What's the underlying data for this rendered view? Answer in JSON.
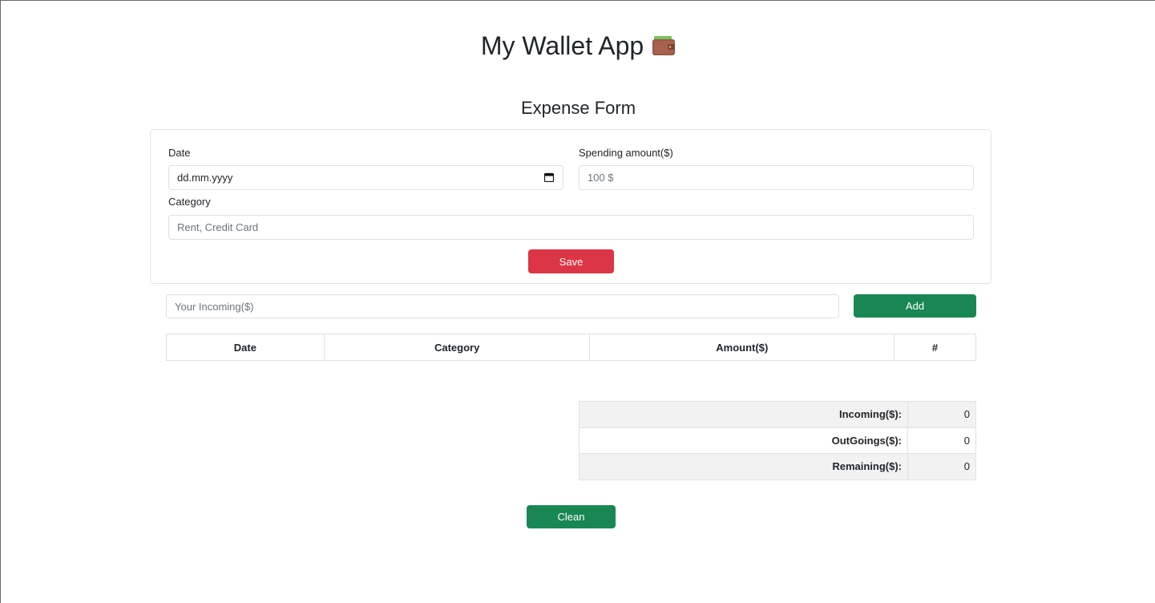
{
  "header": {
    "title": "My Wallet App",
    "icon": "wallet-icon"
  },
  "expense_form": {
    "heading": "Expense Form",
    "date_label": "Date",
    "date_value": "dd.mm.yyyy",
    "amount_label": "Spending amount($)",
    "amount_placeholder": "100 $",
    "category_label": "Category",
    "category_placeholder": "Rent, Credit Card",
    "save_label": "Save"
  },
  "incoming": {
    "placeholder": "Your Incoming($)",
    "add_label": "Add"
  },
  "transactions": {
    "columns": [
      "Date",
      "Category",
      "Amount($)",
      "#"
    ]
  },
  "summary": {
    "rows": [
      {
        "label": "Incoming($):",
        "value": "0"
      },
      {
        "label": "OutGoings($):",
        "value": "0"
      },
      {
        "label": "Remaining($):",
        "value": "0"
      }
    ]
  },
  "clean_label": "Clean",
  "colors": {
    "save": "#dc3545",
    "add": "#198754",
    "clean": "#198754"
  }
}
